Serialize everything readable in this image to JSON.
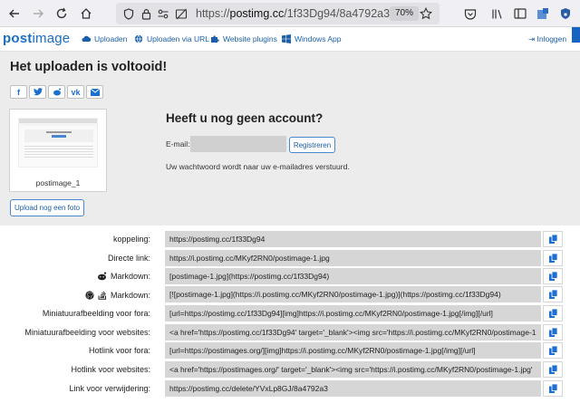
{
  "browser": {
    "url_prefix": "https://",
    "url_domain": "postimg.cc",
    "url_path": "/1f33Dg94/8a4792a3",
    "zoom": "70%"
  },
  "header": {
    "logo_a": "post",
    "logo_b": "image",
    "nav": [
      "Uploaden",
      "Uploaden via URL",
      "Website plugins",
      "Windows App"
    ],
    "login": "Inloggen"
  },
  "upload": {
    "title": "Het uploaden is voltooid!",
    "share": [
      "f",
      "t",
      "r",
      "vk",
      "m"
    ],
    "thumb_caption": "postimage_1",
    "upload_more": "Upload nog een foto"
  },
  "account": {
    "title": "Heeft u nog geen account?",
    "email_label": "E-mail:",
    "email_value": "",
    "register": "Registreren",
    "note": "Uw wachtwoord wordt naar uw e-mailadres verstuurd."
  },
  "links": [
    {
      "label": "koppeling:",
      "value": "https://postimg.cc/1f33Dg94",
      "icon": ""
    },
    {
      "label": "Directe link:",
      "value": "https://i.postimg.cc/MKyf2RN0/postimage-1.jpg",
      "icon": ""
    },
    {
      "label": "Markdown:",
      "value": "[postimage-1.jpg](https://postimg.cc/1f33Dg94)",
      "icon": "reddit-icon"
    },
    {
      "label": "Markdown:",
      "value": "[![postimage-1.jpg](https://i.postimg.cc/MKyf2RN0/postimage-1.jpg)](https://postimg.cc/1f33Dg94)",
      "icon": "github-stackoverflow-icon"
    },
    {
      "label": "Miniatuurafbeelding voor fora:",
      "value": "[url=https://postimg.cc/1f33Dg94][img]https://i.postimg.cc/MKyf2RN0/postimage-1.jpg[/img][/url]",
      "icon": ""
    },
    {
      "label": "Miniatuurafbeelding voor websites:",
      "value": "<a href='https://postimg.cc/1f33Dg94' target='_blank'><img src='https://i.postimg.cc/MKyf2RN0/postimage-1",
      "icon": ""
    },
    {
      "label": "Hotlink voor fora:",
      "value": "[url=https://postimages.org/][img]https://i.postimg.cc/MKyf2RN0/postimage-1.jpg[/img][/url]",
      "icon": ""
    },
    {
      "label": "Hotlink voor websites:",
      "value": "<a href='https://postimages.org/' target='_blank'><img src='https://i.postimg.cc/MKyf2RN0/postimage-1.jpg'",
      "icon": ""
    },
    {
      "label": "Link voor verwijdering:",
      "value": "https://postimg.cc/delete/YVxLp8GJ/8a4792a3",
      "icon": ""
    }
  ],
  "colors": {
    "accent": "#1b5fa8",
    "field_bg": "#d6d6d6",
    "panel_bg": "#ececec"
  }
}
